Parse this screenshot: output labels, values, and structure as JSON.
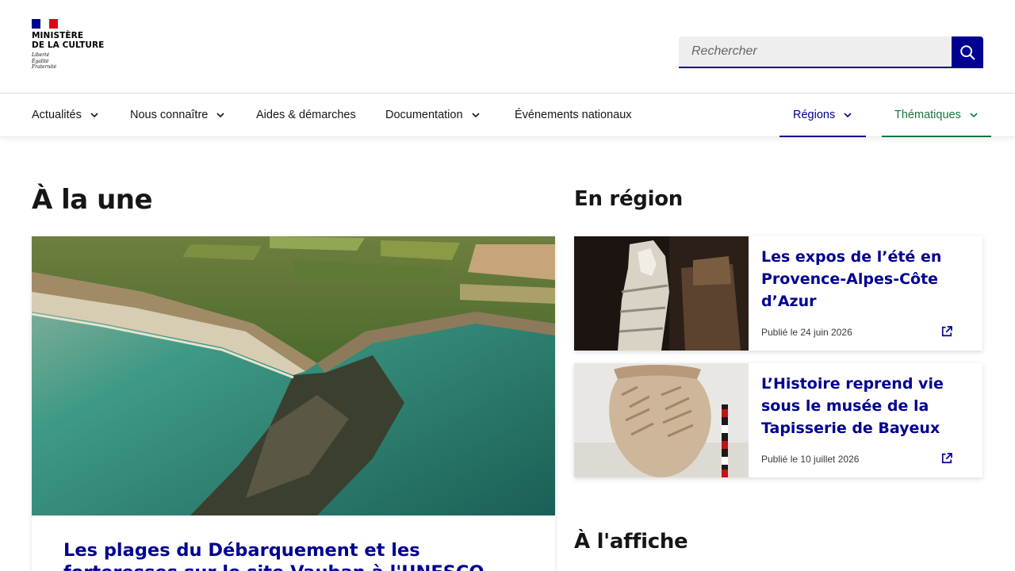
{
  "header": {
    "logo": {
      "line1": "MINISTÈRE",
      "line2": "DE LA CULTURE",
      "motto1": "Liberté",
      "motto2": "Égalité",
      "motto3": "Fraternité",
      "flag_colors": [
        "#000091",
        "#ffffff",
        "#e1000f"
      ]
    },
    "search": {
      "placeholder": "Rechercher",
      "button_icon": "search-icon"
    }
  },
  "nav": {
    "items": [
      {
        "label": "Actualités",
        "has_dropdown": true
      },
      {
        "label": "Nous connaître",
        "has_dropdown": true
      },
      {
        "label": "Aides & démarches",
        "has_dropdown": false
      },
      {
        "label": "Documentation",
        "has_dropdown": true
      },
      {
        "label": "Événements nationaux",
        "has_dropdown": false
      },
      {
        "label": "Régions",
        "has_dropdown": true
      },
      {
        "label": "Thématiques",
        "has_dropdown": true
      }
    ]
  },
  "main": {
    "headline_section": {
      "heading": "À la une",
      "feature": {
        "title": "Les plages du Débarquement et les forteresses sur le site Vauban à l'UNESCO"
      }
    },
    "region_section": {
      "heading": "En région",
      "cards": [
        {
          "title": "Les expos de l’été en Provence-Alpes-Côte d’Azur",
          "date": "Publié le 24 juin 2026",
          "icon": "external-link-icon"
        },
        {
          "title": "L’Histoire reprend vie sous le musée de la Tapisserie de Bayeux",
          "date": "Publié le 10 juillet 2026",
          "icon": "external-link-icon"
        }
      ]
    },
    "affiche_section": {
      "heading": "À l'affiche"
    }
  },
  "colors": {
    "primary_blue": "#000091",
    "green_accent": "#18753c",
    "search_bg": "#eeeeee"
  }
}
